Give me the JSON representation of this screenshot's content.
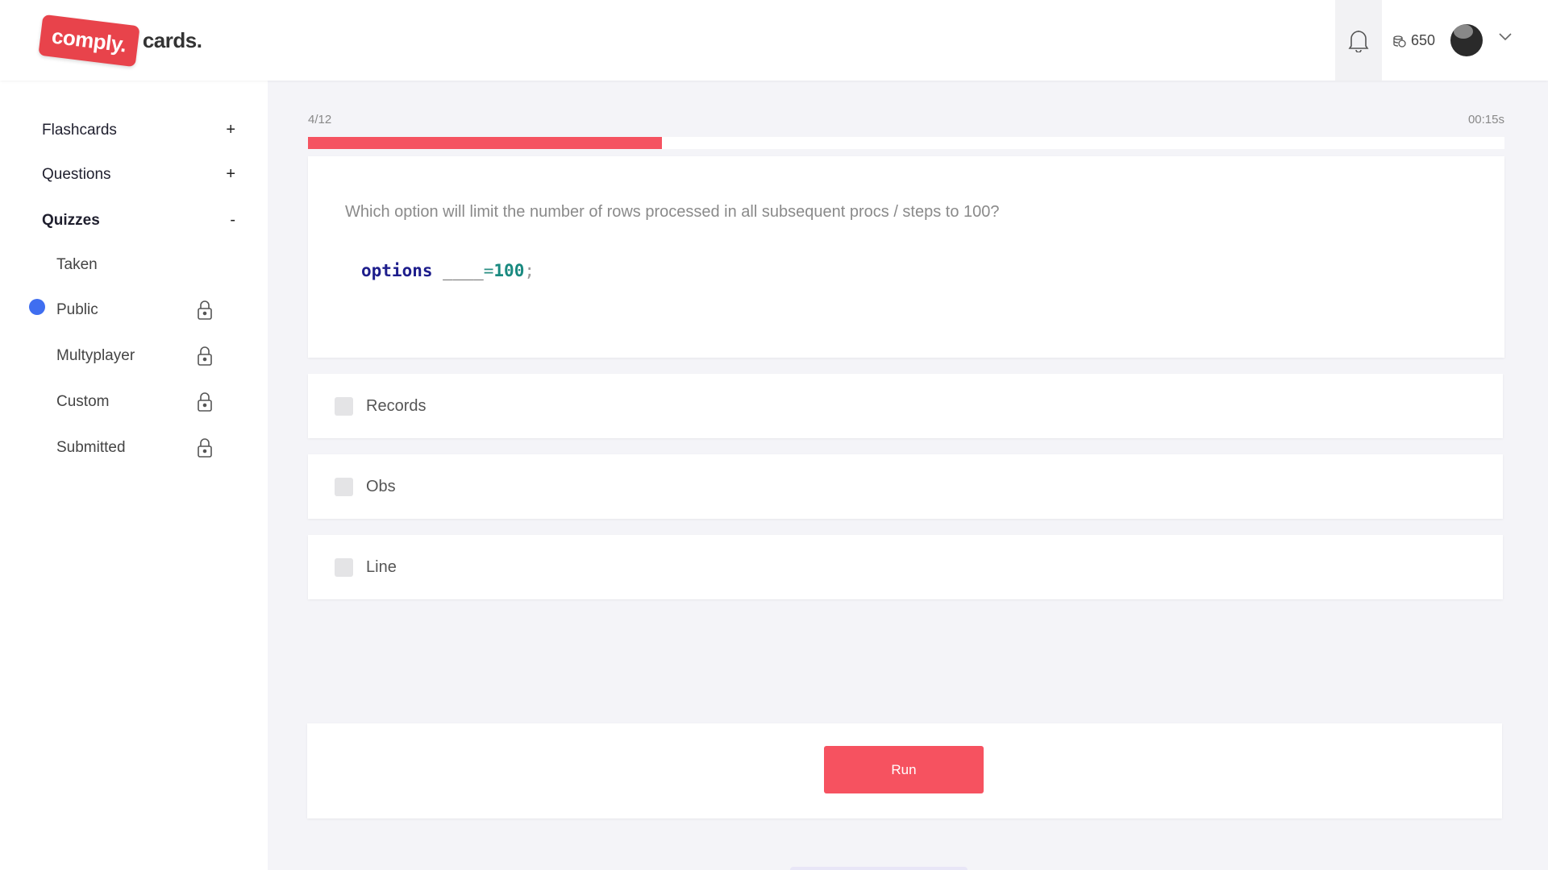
{
  "brand": {
    "badge": "comply.",
    "name": "cards."
  },
  "header": {
    "coins": "650"
  },
  "sidebar": {
    "sections": [
      {
        "label": "Flashcards",
        "sign": "+"
      },
      {
        "label": "Questions",
        "sign": "+"
      },
      {
        "label": "Quizzes",
        "sign": "-"
      }
    ],
    "quiz_items": [
      {
        "label": "Taken",
        "locked": false
      },
      {
        "label": "Public",
        "locked": true,
        "active": true
      },
      {
        "label": "Multyplayer",
        "locked": true
      },
      {
        "label": "Custom",
        "locked": true
      },
      {
        "label": "Submitted",
        "locked": true
      }
    ]
  },
  "quiz": {
    "counter": "4/12",
    "timer": "00:15s",
    "progress": 0.296,
    "question": "Which option will limit the number of rows processed in all subsequent procs / steps to 100?",
    "code": {
      "keyword": "options",
      "blank": "____",
      "equals": "=",
      "number": "100",
      "semi": ";"
    },
    "options": [
      "Records",
      "Obs",
      "Line"
    ],
    "run_label": "Run"
  },
  "colors": {
    "accent": "#f55361",
    "active_dot": "#3f6ef0"
  }
}
